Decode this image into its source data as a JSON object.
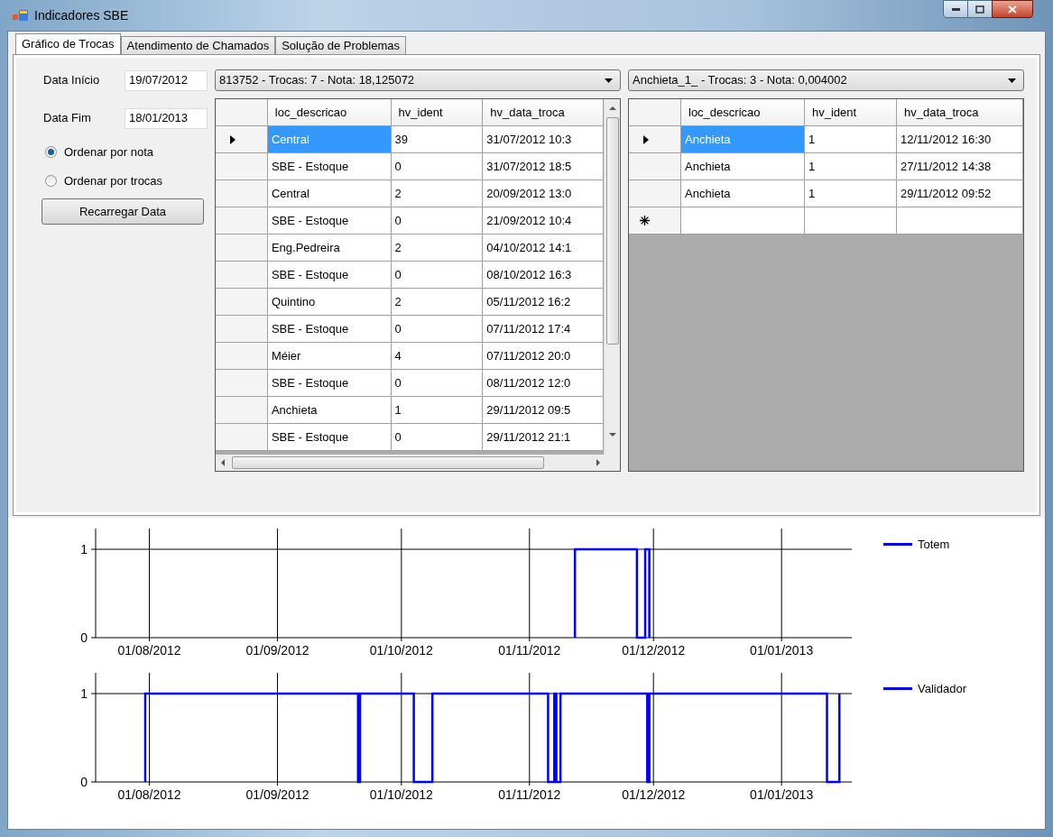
{
  "window": {
    "title": "Indicadores SBE"
  },
  "tabs": [
    {
      "label": "Gráfico de Trocas",
      "selected": true
    },
    {
      "label": "Atendimento de Chamados",
      "selected": false
    },
    {
      "label": "Solução de Problemas",
      "selected": false
    }
  ],
  "filters": {
    "start_label": "Data Início",
    "start_value": "19/07/2012",
    "end_label": "Data Fim",
    "end_value": "18/01/2013"
  },
  "sort_options": [
    {
      "label": "Ordenar por nota",
      "selected": true
    },
    {
      "label": "Ordenar por trocas",
      "selected": false
    }
  ],
  "reload_button": "Recarregar Data",
  "combo_left": {
    "value": "813752 - Trocas: 7 - Nota: 18,125072"
  },
  "combo_right": {
    "value": "Anchieta_1_ - Trocas: 3 - Nota: 0,004002"
  },
  "grid_left": {
    "columns": [
      "loc_descricao",
      "hv_ident",
      "hv_data_troca"
    ],
    "new_row": false,
    "rows": [
      {
        "current": true,
        "cells": [
          "Central",
          "39",
          "31/07/2012 10:3"
        ]
      },
      {
        "current": false,
        "cells": [
          "SBE - Estoque",
          "0",
          "31/07/2012 18:5"
        ]
      },
      {
        "current": false,
        "cells": [
          "Central",
          "2",
          "20/09/2012 13:0"
        ]
      },
      {
        "current": false,
        "cells": [
          "SBE - Estoque",
          "0",
          "21/09/2012 10:4"
        ]
      },
      {
        "current": false,
        "cells": [
          "Eng.Pedreira",
          "2",
          "04/10/2012 14:1"
        ]
      },
      {
        "current": false,
        "cells": [
          "SBE - Estoque",
          "0",
          "08/10/2012 16:3"
        ]
      },
      {
        "current": false,
        "cells": [
          "Quintino",
          "2",
          "05/11/2012 16:2"
        ]
      },
      {
        "current": false,
        "cells": [
          "SBE - Estoque",
          "0",
          "07/11/2012 17:4"
        ]
      },
      {
        "current": false,
        "cells": [
          "Méier",
          "4",
          "07/11/2012 20:0"
        ]
      },
      {
        "current": false,
        "cells": [
          "SBE - Estoque",
          "0",
          "08/11/2012 12:0"
        ]
      },
      {
        "current": false,
        "cells": [
          "Anchieta",
          "1",
          "29/11/2012 09:5"
        ]
      },
      {
        "current": false,
        "cells": [
          "SBE - Estoque",
          "0",
          "29/11/2012 21:1"
        ]
      }
    ]
  },
  "grid_right": {
    "columns": [
      "loc_descricao",
      "hv_ident",
      "hv_data_troca"
    ],
    "new_row": true,
    "rows": [
      {
        "current": true,
        "cells": [
          "Anchieta",
          "1",
          "12/11/2012 16:30"
        ]
      },
      {
        "current": false,
        "cells": [
          "Anchieta",
          "1",
          "27/11/2012 14:38"
        ]
      },
      {
        "current": false,
        "cells": [
          "Anchieta",
          "1",
          "29/11/2012 09:52"
        ]
      }
    ]
  },
  "charts": [
    {
      "legend": "Totem",
      "y_labels": [
        "1",
        "0"
      ],
      "x_labels": [
        "01/08/2012",
        "01/09/2012",
        "01/10/2012",
        "01/11/2012",
        "01/12/2012",
        "01/01/2013"
      ]
    },
    {
      "legend": "Validador",
      "y_labels": [
        "1",
        "0"
      ],
      "x_labels": [
        "01/08/2012",
        "01/09/2012",
        "01/10/2012",
        "01/11/2012",
        "01/12/2012",
        "01/01/2013"
      ]
    }
  ]
}
